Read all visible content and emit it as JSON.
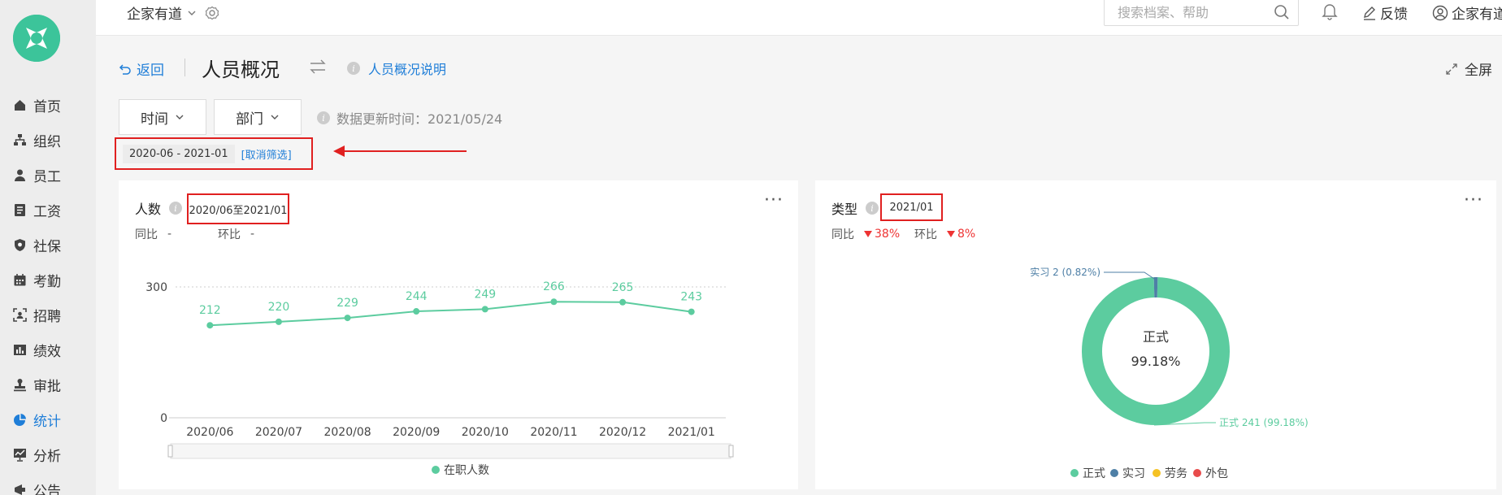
{
  "app": {
    "company": "企家有道",
    "user": "企家有道",
    "feedback": "反馈"
  },
  "search": {
    "placeholder": "搜索档案、帮助"
  },
  "nav": [
    {
      "label": "首页",
      "icon": "home-icon"
    },
    {
      "label": "组织",
      "icon": "org-icon"
    },
    {
      "label": "员工",
      "icon": "person-icon"
    },
    {
      "label": "工资",
      "icon": "salary-icon"
    },
    {
      "label": "社保",
      "icon": "shield-icon"
    },
    {
      "label": "考勤",
      "icon": "calendar-icon"
    },
    {
      "label": "招聘",
      "icon": "recruit-icon"
    },
    {
      "label": "绩效",
      "icon": "bar-chart-icon"
    },
    {
      "label": "审批",
      "icon": "stamp-icon"
    },
    {
      "label": "统计",
      "icon": "pie-chart-icon",
      "active": true
    },
    {
      "label": "分析",
      "icon": "analysis-icon"
    },
    {
      "label": "公告",
      "icon": "notice-icon"
    }
  ],
  "page": {
    "back": "返回",
    "title": "人员概况",
    "help": "人员概况说明",
    "fullscreen": "全屏"
  },
  "filters": {
    "time": "时间",
    "dept": "部门",
    "update_time": "数据更新时间：2021/05/24",
    "range_chip": "2020-06 - 2021-01",
    "cancel": "[取消筛选]"
  },
  "colors": {
    "accent": "#1f7ed8",
    "series": "#5ccc9f",
    "intern": "#4e7fa6",
    "labor": "#f5c224",
    "outsource": "#e84b4b",
    "highlight": "#e02020"
  },
  "headcount": {
    "title": "人数",
    "range": "2020/06至2021/01",
    "yoy_label": "同比",
    "yoy_value": "-",
    "mom_label": "环比",
    "mom_value": "-"
  },
  "type": {
    "title": "类型",
    "range": "2021/01",
    "yoy_label": "同比",
    "yoy_value": "38%",
    "mom_label": "环比",
    "mom_value": "8%",
    "center_label": "正式",
    "center_value": "99.18%"
  },
  "chart_data": [
    {
      "type": "line",
      "categories": [
        "2020/06",
        "2020/07",
        "2020/08",
        "2020/09",
        "2020/10",
        "2020/11",
        "2020/12",
        "2021/01"
      ],
      "series": [
        {
          "name": "在职人数",
          "values": [
            212,
            220,
            229,
            244,
            249,
            266,
            265,
            243
          ]
        }
      ],
      "ylim": [
        0,
        300
      ],
      "yticks": [
        "0",
        "300"
      ],
      "legend": "bottom"
    },
    {
      "type": "pie",
      "categories": [
        "正式",
        "实习",
        "劳务",
        "外包"
      ],
      "values": [
        241,
        2,
        0,
        0
      ],
      "labels": [
        "正式 241 (99.18%)",
        "实习 2 (0.82%)"
      ],
      "legend": "bottom"
    }
  ]
}
